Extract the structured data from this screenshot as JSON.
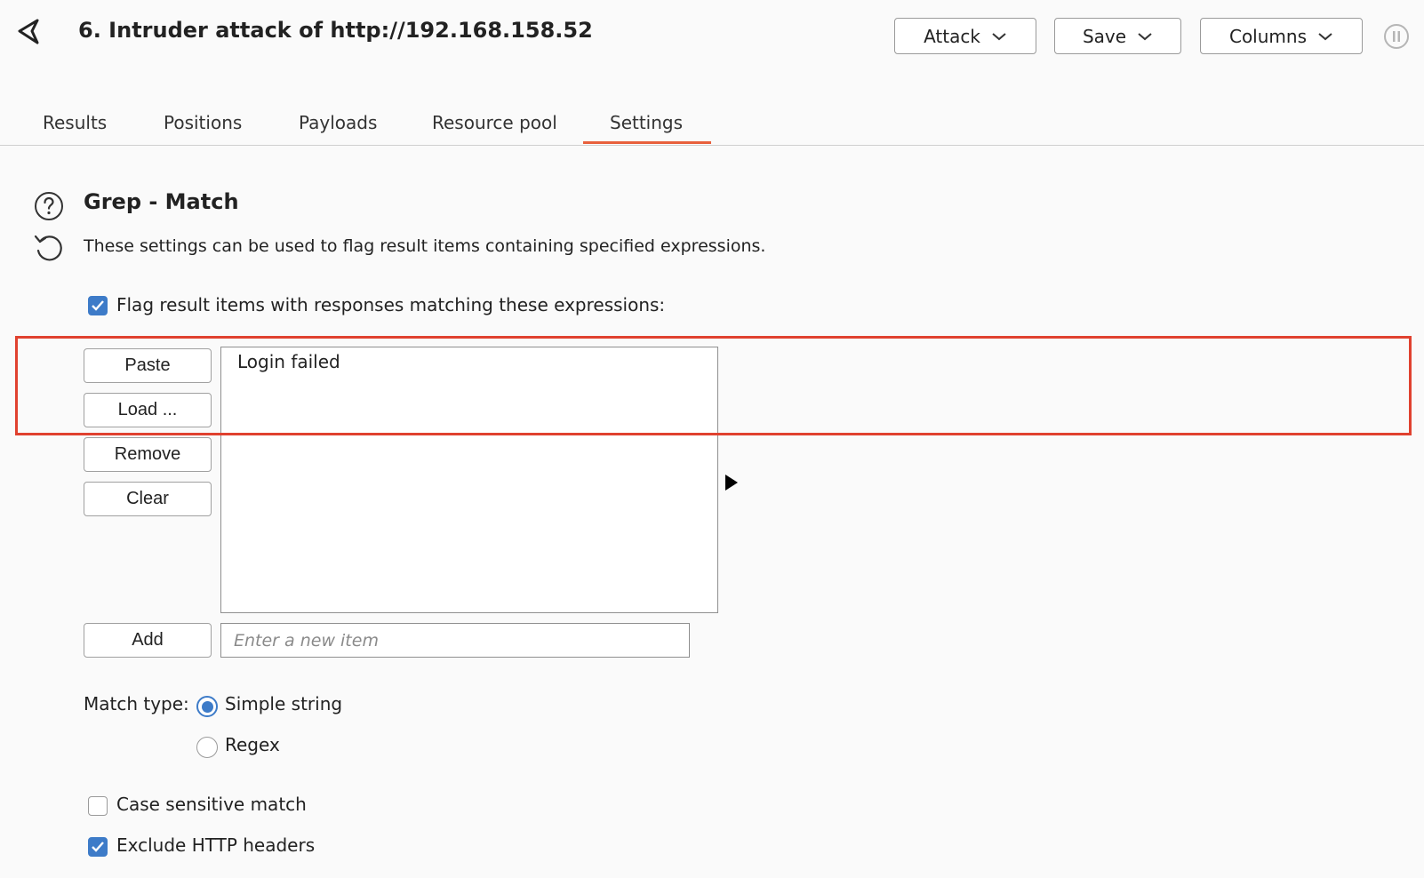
{
  "header": {
    "back_icon": "back-arrow-icon",
    "title": "6. Intruder attack of http://192.168.158.52",
    "buttons": [
      {
        "label": "Attack",
        "icon": "chevron-down-icon"
      },
      {
        "label": "Save",
        "icon": "chevron-down-icon"
      },
      {
        "label": "Columns",
        "icon": "chevron-down-icon"
      }
    ],
    "pause_icon": "pause-icon"
  },
  "tabs": [
    {
      "label": "Results",
      "active": false
    },
    {
      "label": "Positions",
      "active": false
    },
    {
      "label": "Payloads",
      "active": false
    },
    {
      "label": "Resource pool",
      "active": false
    },
    {
      "label": "Settings",
      "active": true
    }
  ],
  "section": {
    "title": "Grep - Match",
    "description": "These settings can be used to flag result items containing specified expressions.",
    "help_icon": "help-icon",
    "reset_icon": "reset-icon"
  },
  "flag_checkbox": {
    "label": "Flag result items with responses matching these expressions:",
    "checked": true
  },
  "list_buttons": {
    "paste": "Paste",
    "load": "Load ...",
    "remove": "Remove",
    "clear": "Clear",
    "add": "Add"
  },
  "list_items": [
    "Login failed"
  ],
  "new_item": {
    "value": "",
    "placeholder": "Enter a new item"
  },
  "match_type": {
    "label": "Match type:",
    "options": [
      {
        "label": "Simple string",
        "selected": true
      },
      {
        "label": "Regex",
        "selected": false
      }
    ]
  },
  "options": {
    "case_sensitive": {
      "label": "Case sensitive match",
      "checked": false
    },
    "exclude_headers": {
      "label": "Exclude HTTP headers",
      "checked": true
    }
  },
  "colors": {
    "accent": "#e8603c",
    "checkbox": "#3d7bc8",
    "highlight": "#e0412f"
  }
}
